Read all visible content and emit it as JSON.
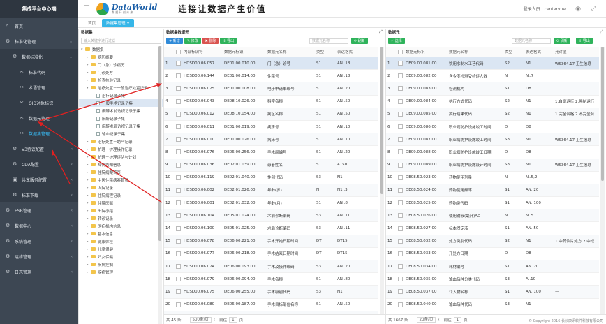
{
  "sidebar": {
    "title": "集成平台中心端",
    "items": [
      {
        "label": "首页",
        "icon": "home-icon",
        "glyph": "⌂",
        "level": 0
      },
      {
        "label": "标准化管理",
        "icon": "gear-icon",
        "glyph": "⚙",
        "level": 0,
        "arrow": "⌄"
      },
      {
        "label": "数据标准化",
        "icon": "gear-icon",
        "glyph": "⚙",
        "level": 1,
        "arrow": "⌄"
      },
      {
        "label": "标准代码",
        "icon": "wrench-icon",
        "glyph": "✂",
        "level": 2
      },
      {
        "label": "术语管理",
        "icon": "wrench-icon",
        "glyph": "✂",
        "level": 2
      },
      {
        "label": "OID对象标识",
        "icon": "wrench-icon",
        "glyph": "✂",
        "level": 2
      },
      {
        "label": "数据元管理",
        "icon": "wrench-icon",
        "glyph": "✂",
        "level": 2
      },
      {
        "label": "数据集管理",
        "icon": "wrench-icon",
        "glyph": "✂",
        "level": 2,
        "active": true
      },
      {
        "label": "V3协议配置",
        "icon": "gear-icon",
        "glyph": "⚙",
        "level": 1,
        "arrow": "‹"
      },
      {
        "label": "CDA配置",
        "icon": "gear-icon",
        "glyph": "⚙",
        "level": 1,
        "arrow": "‹"
      },
      {
        "label": "共享服务配置",
        "icon": "share-icon",
        "glyph": "▣",
        "level": 1,
        "arrow": "‹"
      },
      {
        "label": "标准下载",
        "icon": "gear-icon",
        "glyph": "⚙",
        "level": 1,
        "arrow": "‹"
      },
      {
        "label": "ESB管理",
        "icon": "gear-icon",
        "glyph": "⚙",
        "level": 0,
        "arrow": "‹"
      },
      {
        "label": "数据中心",
        "icon": "gear-icon",
        "glyph": "⚙",
        "level": 0,
        "arrow": "‹"
      },
      {
        "label": "系统管理",
        "icon": "gear-icon",
        "glyph": "⚙",
        "level": 0,
        "arrow": "‹"
      },
      {
        "label": "运维管理",
        "icon": "gear-icon",
        "glyph": "⚙",
        "level": 0,
        "arrow": "‹"
      },
      {
        "label": "日志管理",
        "icon": "gear-icon",
        "glyph": "⚙",
        "level": 0,
        "arrow": "‹"
      }
    ]
  },
  "header": {
    "logo_text": "DataWorld",
    "logo_sub": "数 据 开 创 未 来",
    "slogan": "连接让数据产生价值",
    "user_label": "登录人员：centervue"
  },
  "tabs": [
    {
      "label": "首页",
      "active": false
    },
    {
      "label": "数据集管理 ×",
      "active": true
    }
  ],
  "tree": {
    "title": "数据集",
    "search_placeholder": "输入关键字进行过滤",
    "nodes": [
      {
        "label": "数据集",
        "indent": 0,
        "type": "folder",
        "tog": "▾"
      },
      {
        "label": "病历概要",
        "indent": 1,
        "type": "folder",
        "tog": "▸"
      },
      {
        "label": "门（急）诊病历",
        "indent": 1,
        "type": "folder",
        "tog": "▸"
      },
      {
        "label": "门诊处方",
        "indent": 1,
        "type": "folder",
        "tog": "▸"
      },
      {
        "label": "检查检验记录",
        "indent": 1,
        "type": "folder",
        "tog": "▸"
      },
      {
        "label": "治疗处置－一般治疗处置记录",
        "indent": 1,
        "type": "folder",
        "tog": "▾"
      },
      {
        "label": "治疗记录子集",
        "indent": 2,
        "type": "file"
      },
      {
        "label": "一般手术记录子集",
        "indent": 2,
        "type": "file",
        "selected": true
      },
      {
        "label": "麻醉术前访视记录子集",
        "indent": 2,
        "type": "file"
      },
      {
        "label": "麻醉记录子集",
        "indent": 2,
        "type": "file"
      },
      {
        "label": "麻醉术后访视记录子集",
        "indent": 2,
        "type": "file"
      },
      {
        "label": "输血记录子集",
        "indent": 2,
        "type": "file"
      },
      {
        "label": "治疗处置－助产记录",
        "indent": 1,
        "type": "folder",
        "tog": "▸"
      },
      {
        "label": "护理－护理操作记录",
        "indent": 1,
        "type": "folder",
        "tog": "▸"
      },
      {
        "label": "护理－护理评估与计划",
        "indent": 1,
        "type": "folder",
        "tog": "▸"
      },
      {
        "label": "知情告知信息",
        "indent": 1,
        "type": "folder",
        "tog": "▸"
      },
      {
        "label": "住院病案首页",
        "indent": 1,
        "type": "folder",
        "tog": "▸"
      },
      {
        "label": "中医住院病案首页",
        "indent": 1,
        "type": "folder",
        "tog": "▸"
      },
      {
        "label": "入院记录",
        "indent": 1,
        "type": "folder",
        "tog": "▸"
      },
      {
        "label": "住院病程记录",
        "indent": 1,
        "type": "folder",
        "tog": "▸"
      },
      {
        "label": "住院医嘱",
        "indent": 1,
        "type": "folder",
        "tog": "▸"
      },
      {
        "label": "出院小结",
        "indent": 1,
        "type": "folder",
        "tog": "▸"
      },
      {
        "label": "转诊记录",
        "indent": 1,
        "type": "folder",
        "tog": "▸"
      },
      {
        "label": "医疗机构信息",
        "indent": 1,
        "type": "folder",
        "tog": "▸"
      },
      {
        "label": "基本信息",
        "indent": 1,
        "type": "folder",
        "tog": "▸"
      },
      {
        "label": "健康体检",
        "indent": 1,
        "type": "folder",
        "tog": "▸"
      },
      {
        "label": "儿童保健",
        "indent": 1,
        "type": "folder",
        "tog": "▸"
      },
      {
        "label": "妇女保健",
        "indent": 1,
        "type": "folder",
        "tog": "▸"
      },
      {
        "label": "疾病控制",
        "indent": 1,
        "type": "folder",
        "tog": "▸"
      },
      {
        "label": "疾病管理",
        "indent": 1,
        "type": "folder",
        "tog": "▸"
      }
    ]
  },
  "dataset_grid": {
    "title": "数据集数据元",
    "buttons": [
      {
        "label": "新增",
        "color": "b",
        "icon": "plus-icon"
      },
      {
        "label": "修改",
        "color": "g",
        "icon": "edit-icon"
      },
      {
        "label": "删除",
        "color": "r",
        "icon": "trash-icon"
      },
      {
        "label": "导出",
        "color": "g",
        "icon": "export-icon"
      }
    ],
    "search_placeholder": "数据元名称",
    "search_button": "刷新",
    "columns": [
      "",
      "",
      "内部标识符",
      "数据元标识",
      "数据元名称",
      "类型",
      "表达格式"
    ],
    "rows": [
      [
        "1",
        "HDSD00.06.057",
        "DE01.00.010.00",
        "门（急）诊号",
        "S1",
        "AN..18"
      ],
      [
        "2",
        "HDSD00.06.144",
        "DE01.00.014.00",
        "住院号",
        "S1",
        "AN..18"
      ],
      [
        "3",
        "HDSD00.06.025",
        "DE01.00.008.00",
        "电子申请单编号",
        "S1",
        "AN..20"
      ],
      [
        "4",
        "HDSD00.06.043",
        "DE08.10.026.00",
        "科室名称",
        "S1",
        "AN..50"
      ],
      [
        "5",
        "HDSD00.06.012",
        "DE08.10.054.00",
        "病区名称",
        "S1",
        "AN..50"
      ],
      [
        "6",
        "HDSD00.06.011",
        "DE01.00.019.00",
        "病房号",
        "S1",
        "AN..10"
      ],
      [
        "7",
        "HDSD00.06.010",
        "DE01.00.026.00",
        "病床号",
        "S1",
        "AN..10"
      ],
      [
        "8",
        "HDSD00.06.076",
        "DE06.00.256.00",
        "手术间编号",
        "S1",
        "AN..20"
      ],
      [
        "9",
        "HDSD00.06.036",
        "DE02.01.039.00",
        "患者姓名",
        "S1",
        "A..50"
      ],
      [
        "10",
        "HDSD00.06.119",
        "DE02.01.040.00",
        "性别代码",
        "S3",
        "N1"
      ],
      [
        "11",
        "HDSD00.06.002",
        "DE02.01.026.00",
        "年龄(岁)",
        "N",
        "N1..3"
      ],
      [
        "12",
        "HDSD00.06.001",
        "DE02.01.032.00",
        "年龄(月)",
        "S1",
        "AN..8"
      ],
      [
        "13",
        "HDSD00.06.104",
        "DE05.01.024.00",
        "术前诊断编码",
        "S3",
        "AN..11"
      ],
      [
        "14",
        "HDSD00.06.100",
        "DE05.01.025.00",
        "术后诊断编码",
        "S3",
        "AN..11"
      ],
      [
        "15",
        "HDSD00.06.078",
        "DE06.00.221.00",
        "手术开始日期时间",
        "DT",
        "DT15"
      ],
      [
        "16",
        "HDSD00.06.077",
        "DE06.00.218.00",
        "手术结束日期时间",
        "DT",
        "DT15"
      ],
      [
        "17",
        "HDSD00.06.074",
        "DE06.00.093.00",
        "手术及操作编码",
        "S3",
        "AN..20"
      ],
      [
        "18",
        "HDSD00.06.079",
        "DE06.00.094.00",
        "手术名称",
        "S1",
        "AN..80"
      ],
      [
        "19",
        "HDSD00.06.075",
        "DE06.00.255.00",
        "手术级别代码",
        "S3",
        "N1"
      ],
      [
        "20",
        "HDSD00.06.080",
        "DE06.00.187.00",
        "手术目标部位名称",
        "S1",
        "AN..50"
      ],
      [
        "21",
        "HDSD00.06.040",
        "DE08.50.037.00",
        "介入物名称",
        "S1",
        "AN..100"
      ]
    ],
    "footer": {
      "total": "共 45 条",
      "page_size": "500条/页",
      "prev": "前往",
      "page": "1",
      "unit": "页"
    }
  },
  "element_grid": {
    "title": "数据元",
    "buttons": [
      {
        "label": "选择",
        "color": "g",
        "icon": "check-icon"
      }
    ],
    "search_placeholder": "数据元名称",
    "search_button": "刷新",
    "export_button": "导出",
    "columns": [
      "",
      "",
      "数据元标识",
      "数据元名称",
      "类型",
      "表达格式",
      "允许值"
    ],
    "rows": [
      [
        "1",
        "DE09.00.081.00",
        "饮用水制水工艺代码",
        "S2",
        "N1",
        "WS364.17 卫生信息"
      ],
      [
        "2",
        "DE09.00.082.00",
        "含今度检测受检评人数",
        "N",
        "N..7",
        ""
      ],
      [
        "3",
        "DE09.00.083.00",
        "检测机构",
        "S1",
        "D8",
        ""
      ],
      [
        "4",
        "DE09.00.084.00",
        "执行方式代码",
        "S2",
        "N1",
        "1.自觉运行 2.强制运行"
      ],
      [
        "5",
        "DE09.00.085.00",
        "执行结果代码",
        "S2",
        "N1",
        "1.完全合格 2.不完全合格"
      ],
      [
        "6",
        "DE09.00.086.00",
        "职业病防护设施竣工时间",
        "D",
        "D8",
        ""
      ],
      [
        "7",
        "DE09.00.087.00",
        "职业病防护设施竣工时间",
        "S3",
        "N1",
        "WS364.17 卫生信息"
      ],
      [
        "8",
        "DE09.00.088.00",
        "职业病防护设施竣工日期",
        "D",
        "D8",
        ""
      ],
      [
        "9",
        "DE09.00.089.00",
        "职业病防护设施设计时间",
        "S3",
        "N1",
        "WS364.17 卫生信息"
      ],
      [
        "10",
        "DE08.50.023.00",
        "药物使用剂量",
        "N",
        "N..5,2",
        ""
      ],
      [
        "11",
        "DE08.50.024.00",
        "药物使用频率",
        "S1",
        "AN..20",
        ""
      ],
      [
        "12",
        "DE08.50.025.00",
        "药物类代码",
        "S1",
        "AN..100",
        ""
      ],
      [
        "13",
        "DE08.50.026.00",
        "使用输液(毫升)AD",
        "N",
        "N..5",
        ""
      ],
      [
        "14",
        "DE08.50.027.00",
        "标本固定液",
        "S1",
        "AN..50",
        "—"
      ],
      [
        "15",
        "DE08.50.032.00",
        "处方类别代码",
        "S2",
        "N1",
        "1.中药饮片处方 2.中成药"
      ],
      [
        "16",
        "DE08.50.033.00",
        "开处方日期",
        "D",
        "D8",
        ""
      ],
      [
        "17",
        "DE08.50.034.00",
        "耗材编号",
        "S1",
        "AN..20",
        ""
      ],
      [
        "18",
        "DE08.50.035.00",
        "输血品种分类代码",
        "S3",
        "A..10",
        "—"
      ],
      [
        "19",
        "DE08.50.037.00",
        "介入物名称",
        "S1",
        "AN..100",
        "—"
      ],
      [
        "20",
        "DE08.50.040.00",
        "输血品种代码",
        "S3",
        "N1",
        "—"
      ]
    ],
    "footer": {
      "total": "共 1667 条",
      "page_size": "20条/页",
      "prev": "前往",
      "page": "1",
      "unit": "页"
    }
  },
  "copyright": "© Copyright 2016 长沙康讯软件科技有限公司"
}
